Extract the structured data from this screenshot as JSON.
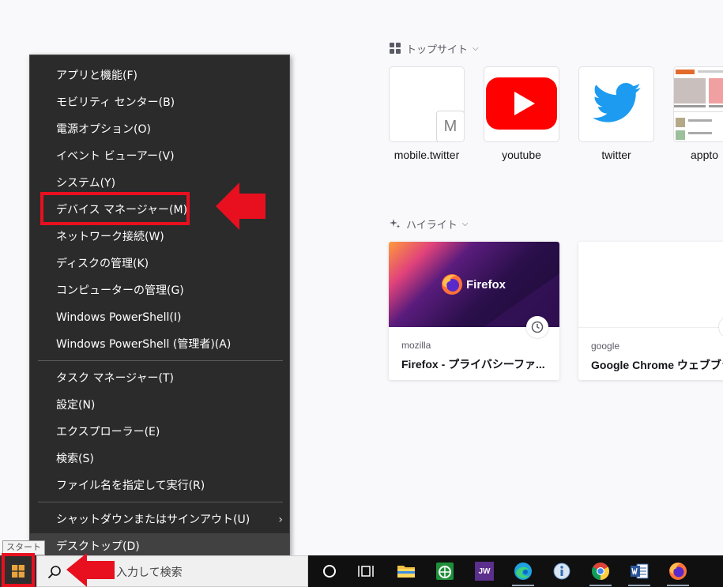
{
  "firefox": {
    "top_sites_title": "トップサイト",
    "top_sites": [
      {
        "label": "mobile.twitter",
        "letter": "M"
      },
      {
        "label": "youtube"
      },
      {
        "label": "twitter"
      },
      {
        "label": "appto"
      }
    ],
    "highlights_title": "ハイライト",
    "highlights": [
      {
        "source": "mozilla",
        "title": "Firefox - プライバシーファ...",
        "brand": "Firefox"
      },
      {
        "source": "google",
        "title": "Google Chrome ウェブブラ"
      }
    ]
  },
  "winx_menu": {
    "items": [
      {
        "label": "アプリと機能(F)"
      },
      {
        "label": "モビリティ センター(B)"
      },
      {
        "label": "電源オプション(O)"
      },
      {
        "label": "イベント ビューアー(V)"
      },
      {
        "label": "システム(Y)"
      },
      {
        "label": "デバイス マネージャー(M)"
      },
      {
        "label": "ネットワーク接続(W)"
      },
      {
        "label": "ディスクの管理(K)"
      },
      {
        "label": "コンピューターの管理(G)"
      },
      {
        "label": "Windows PowerShell(I)"
      },
      {
        "label": "Windows PowerShell (管理者)(A)"
      },
      {
        "label": "タスク マネージャー(T)"
      },
      {
        "label": "設定(N)"
      },
      {
        "label": "エクスプローラー(E)"
      },
      {
        "label": "検索(S)"
      },
      {
        "label": "ファイル名を指定して実行(R)"
      },
      {
        "label": "シャットダウンまたはサインアウト(U)"
      },
      {
        "label": "デスクトップ(D)"
      }
    ]
  },
  "taskbar": {
    "start_tooltip": "スタート",
    "search_text": "入力して検索",
    "jw_label": "JW"
  },
  "colors": {
    "annotation_red": "#e8101f",
    "menu_bg": "#2b2b2b",
    "taskbar_bg": "#101010"
  }
}
